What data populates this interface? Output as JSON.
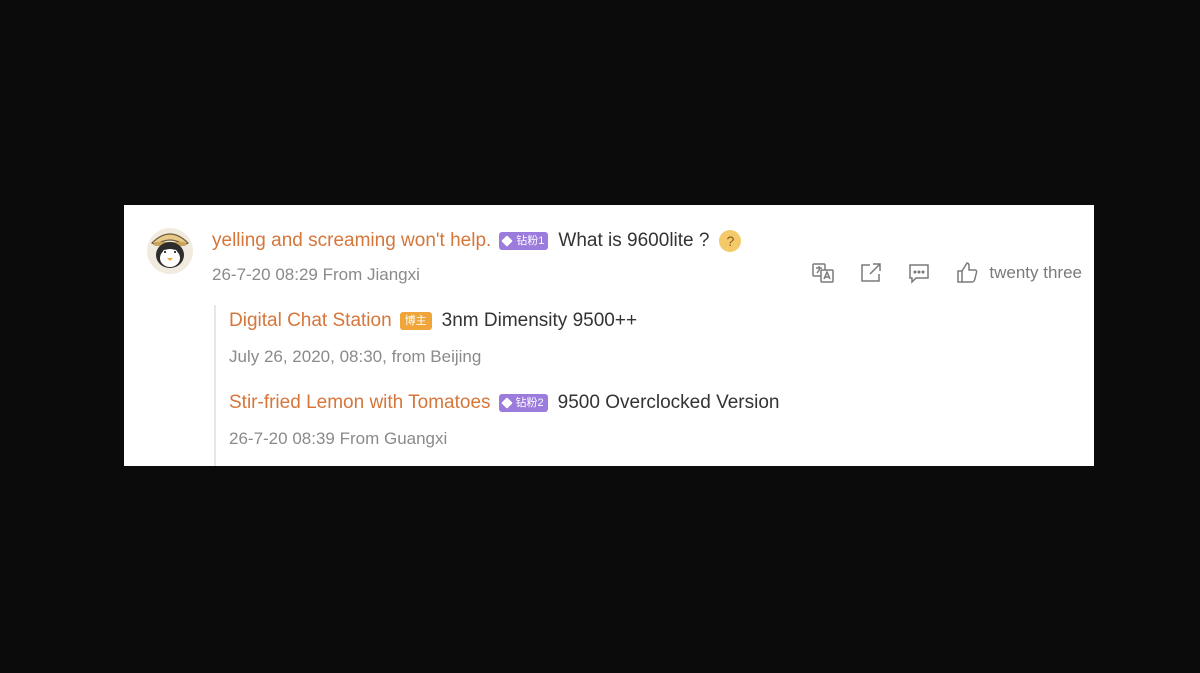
{
  "comment": {
    "username": "yelling and screaming won't help.",
    "badge": "钻粉1",
    "text": "What is 9600lite ?",
    "emoji": "thinking-emoji",
    "meta": "26-7-20 08:29 From Jiangxi",
    "like_count": "twenty three",
    "actions": [
      "translate-icon",
      "share-icon",
      "comment-icon",
      "like-icon"
    ]
  },
  "replies": [
    {
      "username": "Digital Chat Station",
      "badge": "博主",
      "text": "3nm  Dimensity 9500++",
      "meta": "July 26, 2020, 08:30, from Beijing"
    },
    {
      "username": "Stir-fried Lemon with Tomatoes",
      "badge": "钻粉2",
      "text": "9500  Overclocked Version",
      "meta": "26-7-20 08:39 From Guangxi"
    }
  ],
  "colors": {
    "username": "#d5763a",
    "badge_purple": "#9b7bdc",
    "badge_orange": "#f0a53a",
    "meta": "#8a8a8a"
  }
}
